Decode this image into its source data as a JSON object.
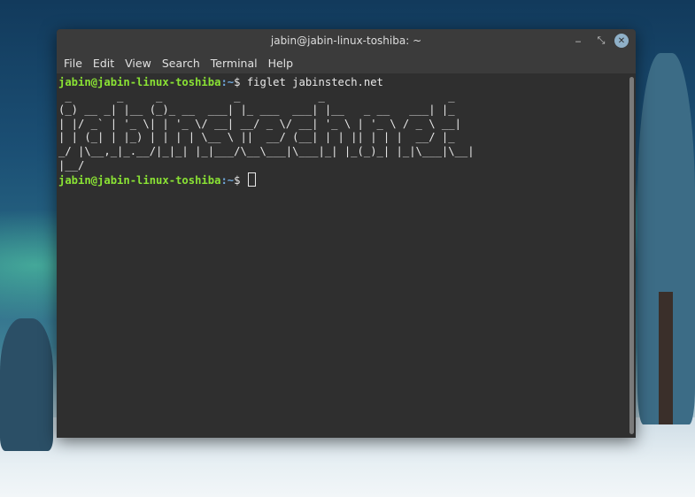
{
  "window": {
    "title": "jabin@jabin-linux-toshiba: ~"
  },
  "window_controls": {
    "minimize": "‒",
    "maximize": "⤡",
    "close": "✕"
  },
  "menu": [
    "File",
    "Edit",
    "View",
    "Search",
    "Terminal",
    "Help"
  ],
  "terminal": {
    "prompt_user_host": "jabin@jabin-linux-toshiba",
    "prompt_path": ":~",
    "prompt_symbol": "$ ",
    "command": "figlet jabinstech.net",
    "figlet_output": " _       _     _           _            _                   _   \n(_) __ _| |__ (_)_ __  ___| |_ ___  ___| |__   _ __   ___| |_ \n| |/ _` | '_ \\| | '_ \\/ __| __/ _ \\/ __| '_ \\ | '_ \\ / _ \\ __|\n| | (_| | |_) | | | | \\__ \\ ||  __/ (__| | | || | | |  __/ |_ \n_/ |\\__,_|_.__/|_|_| |_|___/\\__\\___|\\___|_| |_(_)_| |_|\\___|\\__|\n|__/",
    "prompt2_user_host": "jabin@jabin-linux-toshiba",
    "prompt2_path": ":~",
    "prompt2_symbol": "$ "
  }
}
